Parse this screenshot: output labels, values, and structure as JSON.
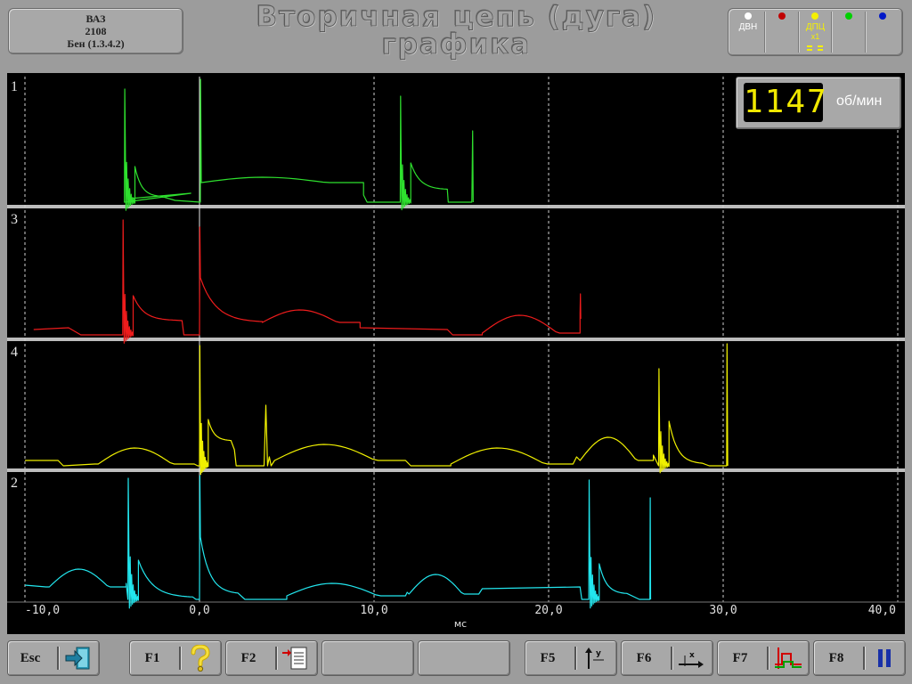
{
  "vehicle": {
    "model": "ВАЗ",
    "code": "2108",
    "engine": "Бен (1.3.4.2)"
  },
  "title": {
    "line1": "Вторичная цепь (дуга)",
    "line2": "графика"
  },
  "sensors": [
    {
      "label": "ДВН",
      "dot_color": "#ffffff"
    },
    {
      "label": "",
      "dot_color": "#c00000"
    },
    {
      "label": "ДПЦ",
      "sub": "x1",
      "dot_color": "#f5f000"
    },
    {
      "label": "",
      "dot_color": "#00d000"
    },
    {
      "label": "",
      "dot_color": "#0018c8"
    }
  ],
  "rpm": {
    "value": "1147",
    "unit": "об/мин"
  },
  "x_axis": {
    "unit": "мс",
    "ticks": [
      {
        "value": -10,
        "label": "-10,0"
      },
      {
        "value": 0,
        "label": "0,0"
      },
      {
        "value": 10,
        "label": "10,0"
      },
      {
        "value": 20,
        "label": "20,0"
      },
      {
        "value": 30,
        "label": "30,0"
      },
      {
        "value": 40,
        "label": "40,0"
      }
    ]
  },
  "channels": [
    {
      "label": "1",
      "color": "#2ee02e"
    },
    {
      "label": "3",
      "color": "#ee1c1c"
    },
    {
      "label": "4",
      "color": "#f0f000"
    },
    {
      "label": "2",
      "color": "#22e6ee"
    }
  ],
  "fkeys": [
    {
      "key": "Esc",
      "icon": "exit-icon"
    },
    {
      "key": "F1",
      "icon": "help-icon"
    },
    {
      "key": "F2",
      "icon": "report-icon"
    },
    {
      "key": "",
      "icon": ""
    },
    {
      "key": "",
      "icon": ""
    },
    {
      "key": "F5",
      "icon": "y-scale-icon"
    },
    {
      "key": "F6",
      "icon": "x-scale-icon"
    },
    {
      "key": "F7",
      "icon": "trigger-icon"
    },
    {
      "key": "F8",
      "icon": "pause-icon"
    }
  ],
  "colors": {
    "background": "#9c9c9c",
    "scope": "#000000",
    "grid": "#cfcfcf",
    "divider": "#bdbdbd"
  }
}
